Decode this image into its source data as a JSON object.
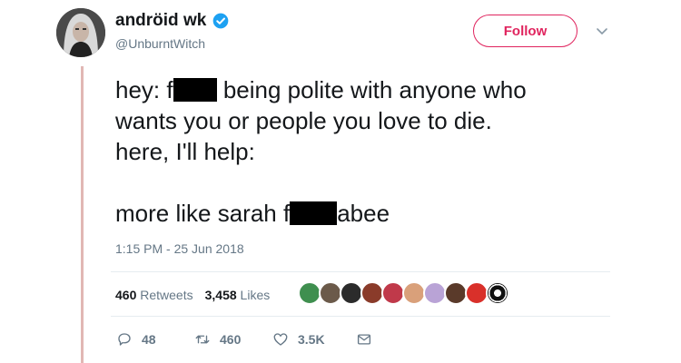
{
  "header": {
    "display_name": "andröid wk",
    "handle": "@UnburntWitch",
    "follow_label": "Follow"
  },
  "tweet": {
    "line1_pre": "hey: f",
    "line1_post": " being polite with anyone who",
    "line2": "wants you or people you love to die.",
    "line3": "here, I'll help:",
    "line4_pre": "more like sarah f",
    "line4_post": "abee",
    "timestamp": "1:15 PM - 25 Jun 2018"
  },
  "stats": {
    "retweets_count": "460",
    "retweets_label": "Retweets",
    "likes_count": "3,458",
    "likes_label": "Likes"
  },
  "actions": {
    "replies": "48",
    "retweets": "460",
    "likes": "3.5K"
  },
  "colors": {
    "verified": "#1da1f2",
    "follow_accent": "#e0245e",
    "thread_line": "#e1b7b4"
  },
  "icons": [
    "verified-badge-icon",
    "chevron-down-icon",
    "reply-icon",
    "retweet-icon",
    "heart-icon",
    "message-icon"
  ]
}
